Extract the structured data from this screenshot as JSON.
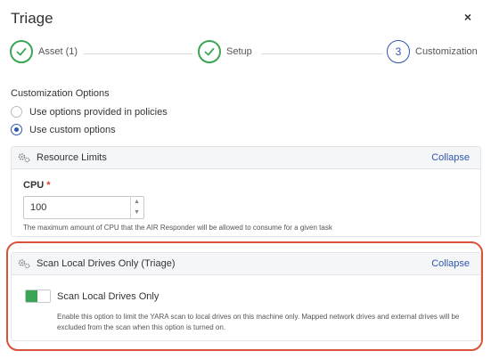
{
  "dialog": {
    "title": "Triage",
    "close_glyph": "×"
  },
  "stepper": {
    "steps": [
      {
        "label": "Asset (1)",
        "state": "complete",
        "icon": "check-icon"
      },
      {
        "label": "Setup",
        "state": "complete",
        "icon": "check-icon"
      },
      {
        "number": "3",
        "label": "Customization",
        "state": "active"
      }
    ]
  },
  "customization": {
    "title": "Customization Options",
    "options": [
      {
        "label": "Use options provided in policies",
        "selected": false
      },
      {
        "label": "Use custom options",
        "selected": true
      }
    ]
  },
  "resource_limits": {
    "title": "Resource Limits",
    "collapse_label": "Collapse",
    "cpu_label": "CPU",
    "required_mark": "*",
    "cpu_value": "100",
    "cpu_help": "The maximum amount of CPU that the AIR Responder will be allowed to consume for a given task"
  },
  "scan_local": {
    "title": "Scan Local Drives Only (Triage)",
    "collapse_label": "Collapse",
    "toggle_label": "Scan Local Drives Only",
    "toggle_on": true,
    "help": "Enable this option to limit the YARA scan to local drives on this machine only. Mapped network drives and external drives will be excluded from the scan when this option is turned on."
  },
  "colors": {
    "accent": "#2f56b0",
    "success": "#3aa655",
    "highlight": "#d9533a"
  }
}
